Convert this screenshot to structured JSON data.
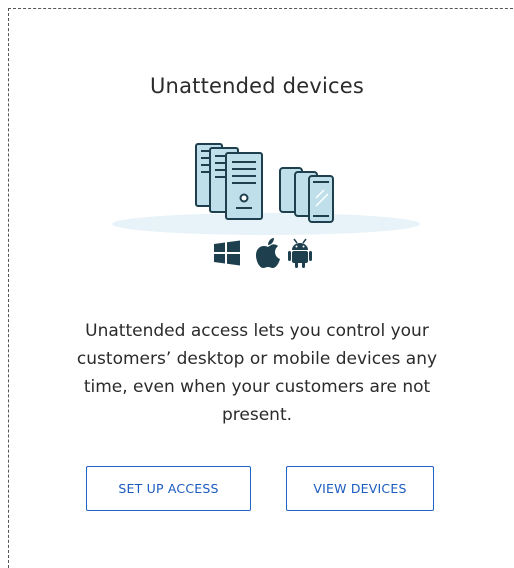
{
  "panel": {
    "title": "Unattended devices",
    "description": "Unattended access lets you control your customers’ desktop or mobile devices any time, even when your customers are not present."
  },
  "buttons": {
    "setup_label": "SET UP ACCESS",
    "view_label": "VIEW DEVICES"
  },
  "icons": {
    "servers": "server-stack-icon",
    "mobiles": "mobile-devices-icon",
    "windows": "windows-icon",
    "apple": "apple-icon",
    "android": "android-icon"
  },
  "colors": {
    "accent": "#1c64c8",
    "illustration_stroke": "#1e3f4d",
    "illustration_fill": "#bfe0ea",
    "platform_bg": "#e7f3f8"
  }
}
